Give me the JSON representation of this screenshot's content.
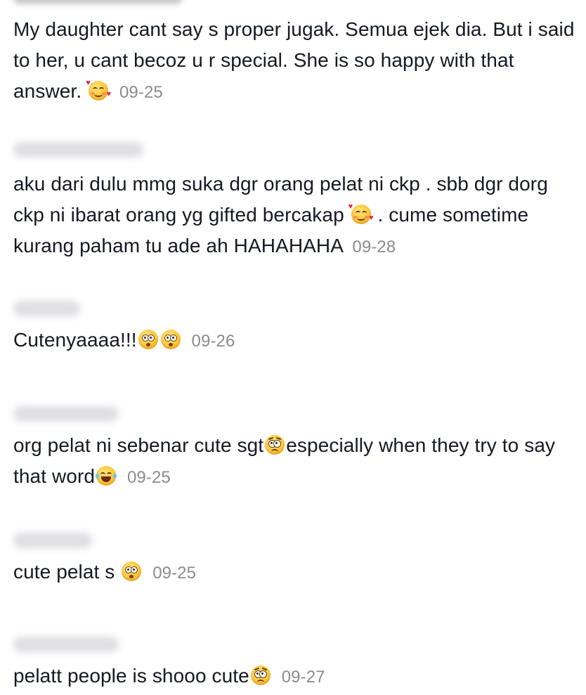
{
  "comments": [
    {
      "text_1": "My daughter cant say s proper jugak. Semua ejek dia. But i said to her, u cant becoz u r special. She is so happy with that answer.",
      "date": "09-25"
    },
    {
      "text_1": "aku dari dulu mmg suka dgr orang pelat ni ckp . sbb dgr dorg ckp ni ibarat orang yg gifted bercakap",
      "text_2": ". cume sometime kurang paham tu ade ah HAHAHAHA",
      "date": "09-28"
    },
    {
      "text_1": "Cutenyaaaa!!!",
      "date": "09-26"
    },
    {
      "text_1": "org pelat ni sebenar cute sgt",
      "text_2": "especially when they try to say that word",
      "date": "09-25"
    },
    {
      "text_1": "cute pelat s",
      "date": "09-25"
    },
    {
      "text_1": "pelatt people is shooo cute",
      "date": "09-27"
    }
  ],
  "icons": {
    "smiling_hearts": "smiling-face-with-hearts-icon",
    "flushed": "flushed-face-icon",
    "pleading": "pleading-face-icon",
    "tears_of_joy": "face-with-tears-of-joy-icon"
  }
}
